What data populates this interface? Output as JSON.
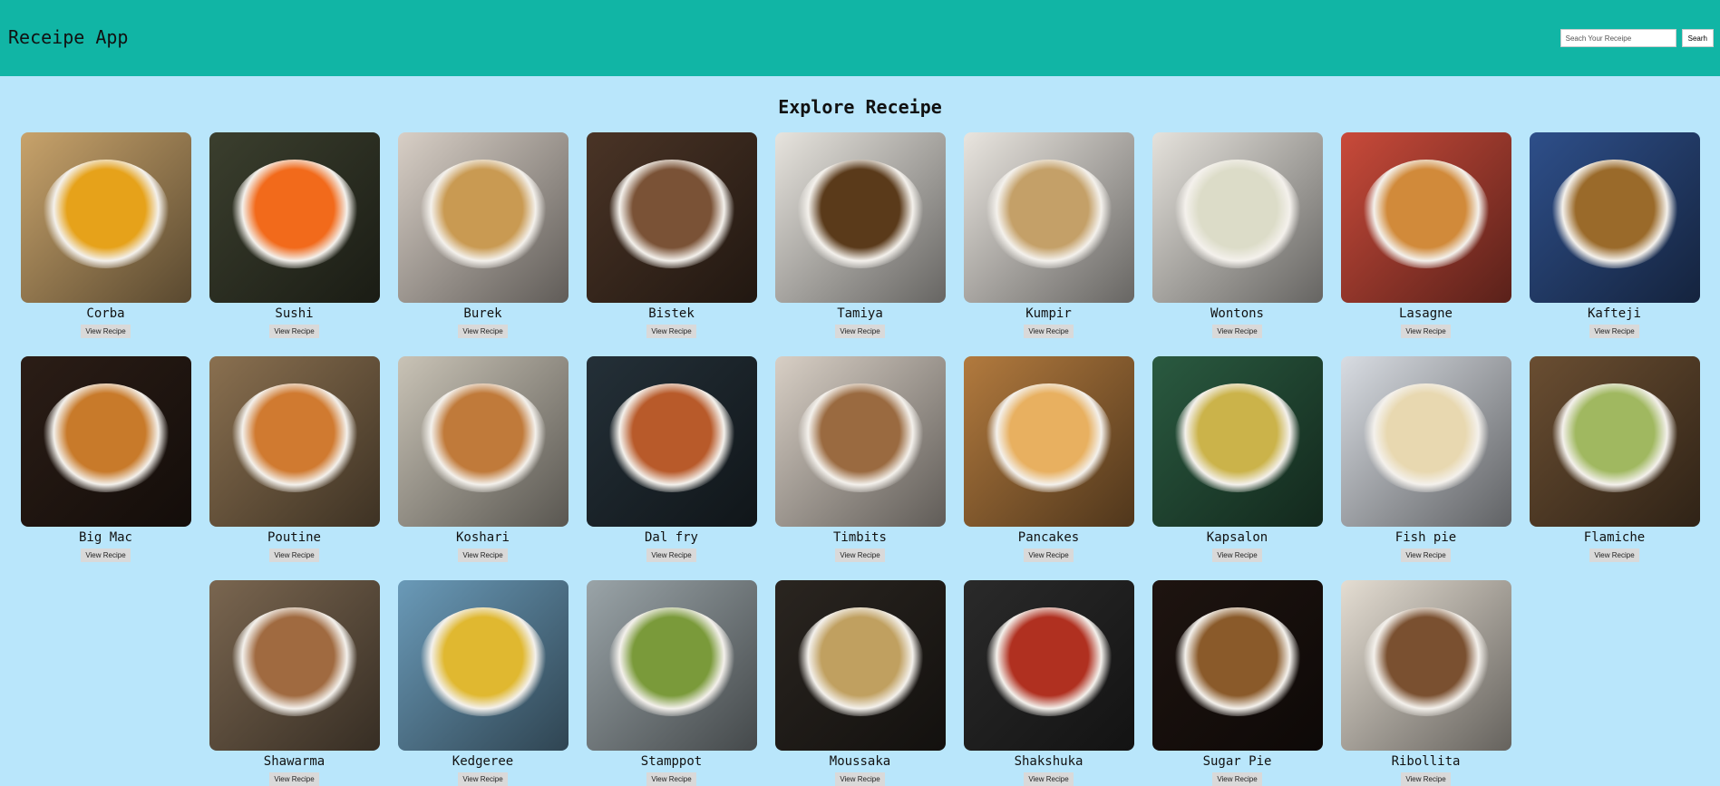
{
  "header": {
    "title": "Receipe App",
    "search_placeholder": "Seach Your Receipe",
    "search_button": "Searh"
  },
  "main": {
    "title": "Explore Receipe",
    "view_label": "View Recipe",
    "recipes": [
      {
        "name": "Corba",
        "bg": "#c8a36b",
        "fg": "#e6a21a"
      },
      {
        "name": "Sushi",
        "bg": "#3b3f2e",
        "fg": "#f26a1b"
      },
      {
        "name": "Burek",
        "bg": "#d8cfc6",
        "fg": "#c99a52"
      },
      {
        "name": "Bistek",
        "bg": "#4a3426",
        "fg": "#7a5236"
      },
      {
        "name": "Tamiya",
        "bg": "#e7e4de",
        "fg": "#5a3a1a"
      },
      {
        "name": "Kumpir",
        "bg": "#e9e5df",
        "fg": "#c4a068"
      },
      {
        "name": "Wontons",
        "bg": "#e5e2dc",
        "fg": "#dcdcc8"
      },
      {
        "name": "Lasagne",
        "bg": "#c94a3a",
        "fg": "#d18a3a"
      },
      {
        "name": "Kafteji",
        "bg": "#2e4f8a",
        "fg": "#9a6a2a"
      },
      {
        "name": "Big Mac",
        "bg": "#2b1d16",
        "fg": "#c87a2a"
      },
      {
        "name": "Poutine",
        "bg": "#8a7050",
        "fg": "#d07a30"
      },
      {
        "name": "Koshari",
        "bg": "#c9c3b6",
        "fg": "#c07a3a"
      },
      {
        "name": "Dal fry",
        "bg": "#243038",
        "fg": "#b85a2a"
      },
      {
        "name": "Timbits",
        "bg": "#d8cfc5",
        "fg": "#9a6a40"
      },
      {
        "name": "Pancakes",
        "bg": "#b27a3e",
        "fg": "#e8b060"
      },
      {
        "name": "Kapsalon",
        "bg": "#2a5a40",
        "fg": "#cbb34a"
      },
      {
        "name": "Fish pie",
        "bg": "#d8dce2",
        "fg": "#e8d8b0"
      },
      {
        "name": "Flamiche",
        "bg": "#6a4e32",
        "fg": "#a0b860"
      },
      {
        "name": "Shawarma",
        "bg": "#7a6650",
        "fg": "#a06a40"
      },
      {
        "name": "Kedgeree",
        "bg": "#6a9ab8",
        "fg": "#e0b830"
      },
      {
        "name": "Stamppot",
        "bg": "#9aa4a8",
        "fg": "#7a9a3a"
      },
      {
        "name": "Moussaka",
        "bg": "#2a2520",
        "fg": "#c0a060"
      },
      {
        "name": "Shakshuka",
        "bg": "#2a2a2a",
        "fg": "#b03020"
      },
      {
        "name": "Sugar Pie",
        "bg": "#1e1410",
        "fg": "#8a5a2a"
      },
      {
        "name": "Ribollita",
        "bg": "#e4ddd2",
        "fg": "#7a5030"
      }
    ]
  }
}
